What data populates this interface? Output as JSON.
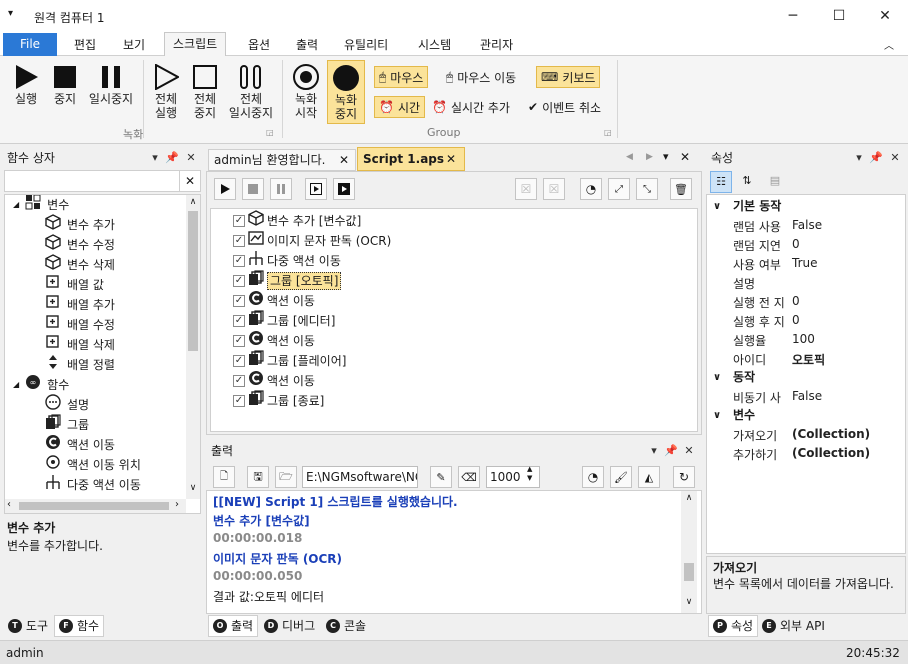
{
  "window": {
    "title": "원격 컴퓨터 1",
    "menu_glyph": "▾",
    "min_glyph": "─",
    "max_glyph": "☐",
    "close_glyph": "✕"
  },
  "ribbon_tabs": [
    "File",
    "편집",
    "보기",
    "스크립트",
    "옵션",
    "출력",
    "유틸리티",
    "시스템",
    "관리자"
  ],
  "ribbon": {
    "run": "실행",
    "stop": "중지",
    "pause": "일시중지",
    "all_run": [
      "전체",
      "실행"
    ],
    "all_stop": [
      "전체",
      "중지"
    ],
    "all_pause": [
      "전체",
      "일시중지"
    ],
    "rec_start": [
      "녹화",
      "시작"
    ],
    "rec_stop": [
      "녹화",
      "중지"
    ],
    "mouse": "마우스",
    "mouse_move": "마우스 이동",
    "keyboard": "키보드",
    "time": "시간",
    "realtime_add": "실시간 추가",
    "event_cancel": "이벤트 취소",
    "group1": "녹화",
    "group2": "Group"
  },
  "func_panel": {
    "title": "함수 상자",
    "search_value": "",
    "items": [
      {
        "label": "변수",
        "level": 0,
        "expand": "◢",
        "icon": "var"
      },
      {
        "label": "변수 추가",
        "level": 1,
        "icon": "cube"
      },
      {
        "label": "변수 수정",
        "level": 1,
        "icon": "cube"
      },
      {
        "label": "변수 삭제",
        "level": 1,
        "icon": "cube"
      },
      {
        "label": "배열 값",
        "level": 1,
        "icon": "arr"
      },
      {
        "label": "배열 추가",
        "level": 1,
        "icon": "arr"
      },
      {
        "label": "배열 수정",
        "level": 1,
        "icon": "arr"
      },
      {
        "label": "배열 삭제",
        "level": 1,
        "icon": "arr"
      },
      {
        "label": "배열 정렬",
        "level": 1,
        "icon": "sort"
      },
      {
        "label": "함수",
        "level": 0,
        "expand": "◢",
        "icon": "fn"
      },
      {
        "label": "설명",
        "level": 1,
        "icon": "dots"
      },
      {
        "label": "그룹",
        "level": 1,
        "icon": "group"
      },
      {
        "label": "액션 이동",
        "level": 1,
        "icon": "c"
      },
      {
        "label": "액션 이동 위치",
        "level": 1,
        "icon": "pos"
      },
      {
        "label": "다중 액션 이동",
        "level": 1,
        "icon": "multi"
      }
    ],
    "desc_title": "변수 추가",
    "desc_text": "변수를 추가합니다.",
    "tabs": [
      {
        "badge": "T",
        "label": "도구"
      },
      {
        "badge": "F",
        "label": "함수"
      }
    ]
  },
  "doc_tabs": [
    {
      "label": "admin님 환영합니다."
    },
    {
      "label": "Script 1.aps"
    }
  ],
  "script_items": [
    {
      "label": "변수 추가 [변수값]",
      "icon": "cube"
    },
    {
      "label": "이미지 문자 판독 (OCR)",
      "icon": "ocr"
    },
    {
      "label": "다중 액션 이동",
      "icon": "multi"
    },
    {
      "label": "그룹 [오토픽]",
      "icon": "group",
      "selected": true
    },
    {
      "label": "액션 이동",
      "icon": "c"
    },
    {
      "label": "그룹 [에디터]",
      "icon": "group"
    },
    {
      "label": "액션 이동",
      "icon": "c"
    },
    {
      "label": "그룹 [플레이어]",
      "icon": "group"
    },
    {
      "label": "액션 이동",
      "icon": "c"
    },
    {
      "label": "그룹 [종료]",
      "icon": "group"
    }
  ],
  "output": {
    "title": "출력",
    "path": "E:\\NGMsoftware\\NG",
    "count": "1000",
    "lines": [
      {
        "text": "[[NEW] Script 1] 스크립트를 실행했습니다.",
        "style": "blue"
      },
      {
        "text": "변수 추가 [변수값]",
        "style": "blue"
      },
      {
        "text": "00:00:00.018",
        "style": "gray"
      },
      {
        "text": "이미지 문자 판독 (OCR)",
        "style": "blue"
      },
      {
        "text": "00:00:00.050",
        "style": "gray"
      },
      {
        "text": "결과 값:오토픽 에디터",
        "style": "normal"
      }
    ],
    "tabs": [
      {
        "badge": "O",
        "label": "출력"
      },
      {
        "badge": "D",
        "label": "디버그"
      },
      {
        "badge": "C",
        "label": "콘솔"
      }
    ]
  },
  "props": {
    "title": "속성",
    "categories": [
      {
        "name": "기본 동작",
        "rows": [
          [
            "랜덤 사용",
            "False"
          ],
          [
            "랜덤 지연",
            "0"
          ],
          [
            "사용 여부",
            "True"
          ],
          [
            "설명",
            ""
          ],
          [
            "실행 전 지",
            "0"
          ],
          [
            "실행 후 지",
            "0"
          ],
          [
            "실행율",
            "100"
          ],
          [
            "아이디",
            "오토픽"
          ]
        ]
      },
      {
        "name": "동작",
        "rows": [
          [
            "비동기 사",
            "False"
          ]
        ]
      },
      {
        "name": "변수",
        "rows": [
          [
            "가져오기",
            "(Collection)"
          ],
          [
            "추가하기",
            "(Collection)"
          ]
        ]
      }
    ],
    "bold_values": [
      "오토픽",
      "(Collection)"
    ],
    "desc_title": "가져오기",
    "desc_text": "변수 목록에서 데이터를 가져옵니다.",
    "tabs": [
      {
        "badge": "P",
        "label": "속성"
      },
      {
        "badge": "E",
        "label": "외부 API"
      }
    ]
  },
  "status": {
    "user": "admin",
    "time": "20:45:32"
  },
  "colors": {
    "accent": "#2b79d6",
    "highlight": "#fbe39a",
    "blue_text": "#1a3fb8",
    "gray_text": "#8a8a8a"
  }
}
